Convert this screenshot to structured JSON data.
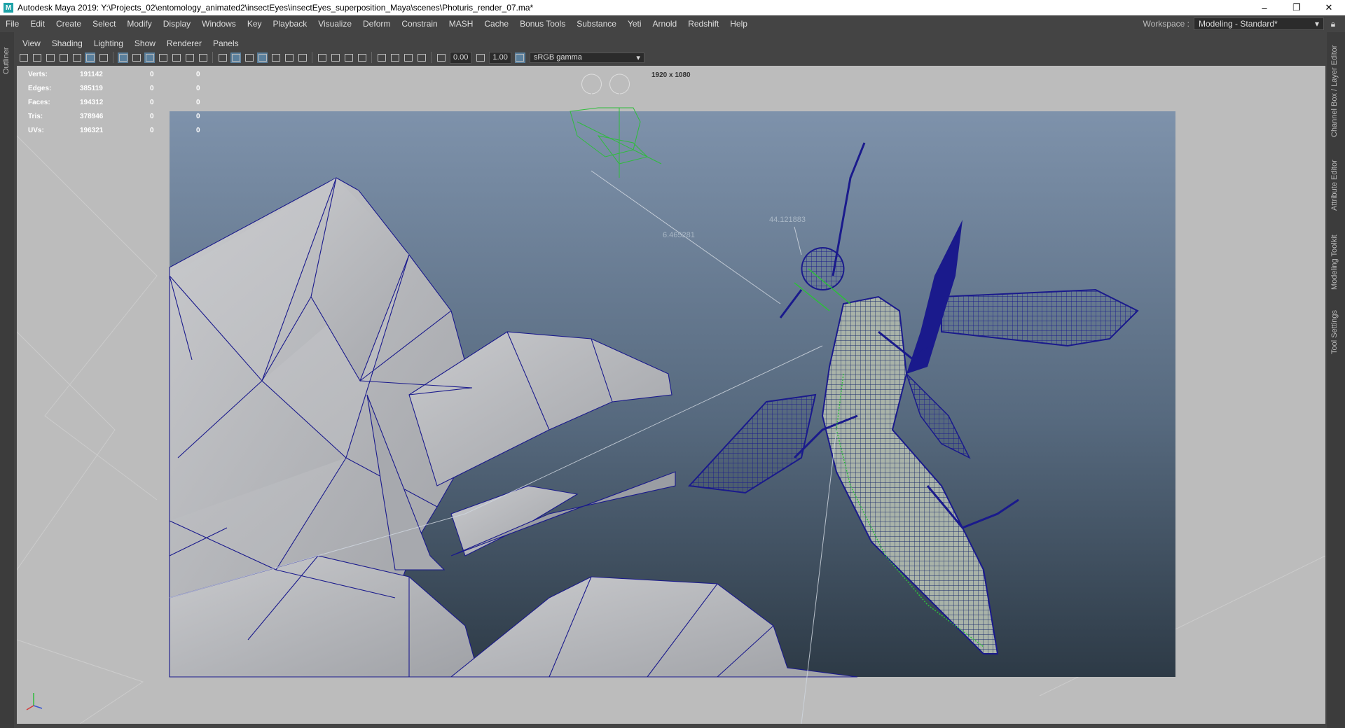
{
  "window": {
    "title": "Autodesk Maya 2019: Y:\\Projects_02\\entomology_animated2\\insectEyes\\insectEyes_superposition_Maya\\scenes\\Photuris_render_07.ma*",
    "app_icon": "maya-icon",
    "controls": {
      "minimize": "–",
      "restore": "❐",
      "close": "✕"
    }
  },
  "menubar": {
    "items": [
      "File",
      "Edit",
      "Create",
      "Select",
      "Modify",
      "Display",
      "Windows",
      "Key",
      "Playback",
      "Visualize",
      "Deform",
      "Constrain",
      "MASH",
      "Cache",
      "Bonus Tools",
      "Substance",
      "Yeti",
      "Arnold",
      "Redshift",
      "Help"
    ],
    "workspace_label": "Workspace :",
    "workspace_value": "Modeling - Standard*"
  },
  "left_strip": {
    "label": "Outliner"
  },
  "right_strip": {
    "labels": [
      "Channel Box / Layer Editor",
      "Attribute Editor",
      "Modeling Toolkit",
      "Tool Settings"
    ]
  },
  "panel_menu": {
    "items": [
      "View",
      "Shading",
      "Lighting",
      "Show",
      "Renderer",
      "Panels"
    ]
  },
  "toolbar": {
    "exposure": "0.00",
    "gamma": "1.00",
    "color_space": "sRGB gamma"
  },
  "hud": {
    "rows": [
      {
        "label": "Verts:",
        "v1": "191142",
        "v2": "0",
        "v3": "0"
      },
      {
        "label": "Edges:",
        "v1": "385119",
        "v2": "0",
        "v3": "0"
      },
      {
        "label": "Faces:",
        "v1": "194312",
        "v2": "0",
        "v3": "0"
      },
      {
        "label": "Tris:",
        "v1": "378946",
        "v2": "0",
        "v3": "0"
      },
      {
        "label": "UVs:",
        "v1": "196321",
        "v2": "0",
        "v3": "0"
      }
    ],
    "resolution": "1920 x 1080"
  },
  "scene": {
    "distance_1": "6.465281",
    "distance_2": "44.121883",
    "colors": {
      "wire": "#1a1a8c",
      "sky_top": "#7e92ab",
      "sky_bottom": "#2d3a46",
      "flower": "#b4b6bb",
      "green_select": "#2ebd3c"
    }
  }
}
